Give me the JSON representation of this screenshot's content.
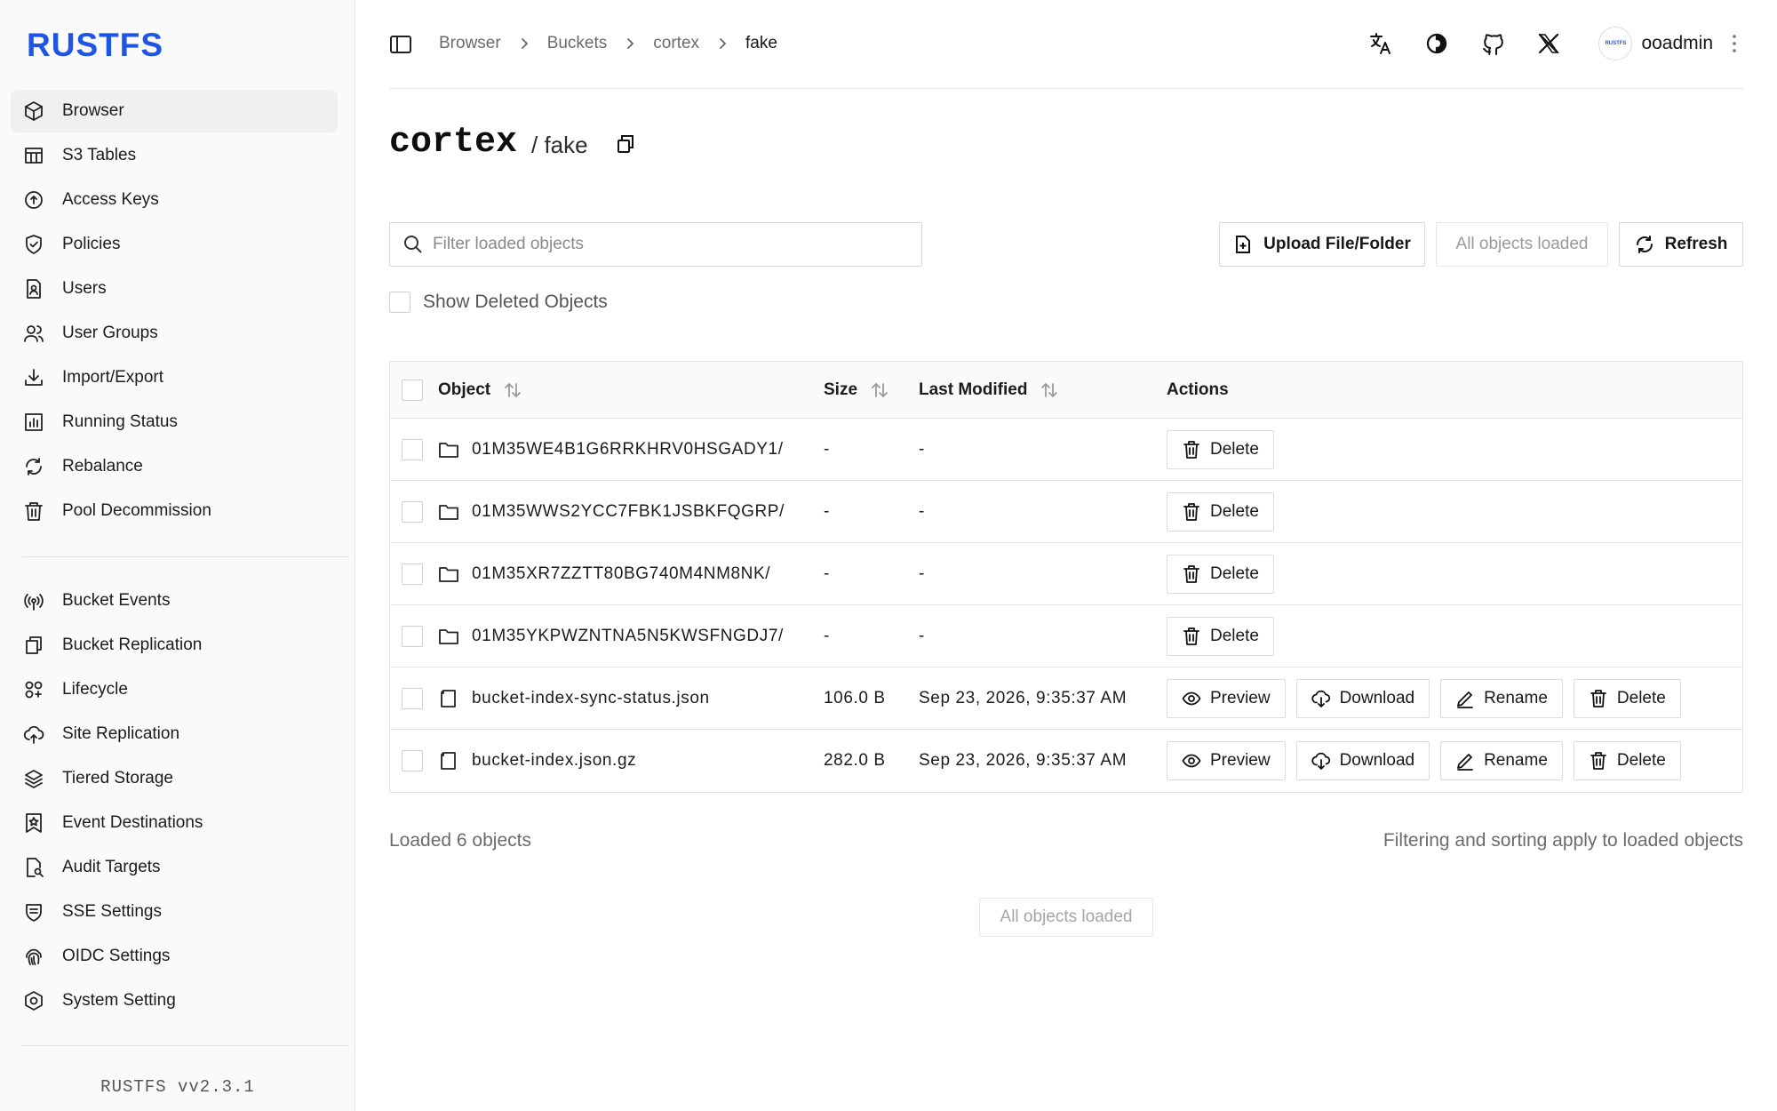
{
  "brand": {
    "logo_text": "RUSTFS",
    "accent": "#1f55e6"
  },
  "sidebar": {
    "primary_items": [
      {
        "label": "Browser",
        "icon": "box-icon",
        "active": true
      },
      {
        "label": "S3 Tables",
        "icon": "table-icon"
      },
      {
        "label": "Access Keys",
        "icon": "key-circle-icon"
      },
      {
        "label": "Policies",
        "icon": "shield-check-icon"
      },
      {
        "label": "Users",
        "icon": "user-badge-icon"
      },
      {
        "label": "User Groups",
        "icon": "users-icon"
      },
      {
        "label": "Import/Export",
        "icon": "import-export-icon"
      },
      {
        "label": "Running Status",
        "icon": "bar-chart-icon"
      },
      {
        "label": "Rebalance",
        "icon": "refresh-icon"
      },
      {
        "label": "Pool Decommission",
        "icon": "trash-icon"
      }
    ],
    "secondary_items": [
      {
        "label": "Bucket Events",
        "icon": "broadcast-icon"
      },
      {
        "label": "Bucket Replication",
        "icon": "copy-icon"
      },
      {
        "label": "Lifecycle",
        "icon": "lifecycle-icon"
      },
      {
        "label": "Site Replication",
        "icon": "cloud-upload-icon"
      },
      {
        "label": "Tiered Storage",
        "icon": "layers-icon"
      },
      {
        "label": "Event Destinations",
        "icon": "star-bookmark-icon"
      },
      {
        "label": "Audit Targets",
        "icon": "file-search-icon"
      },
      {
        "label": "SSE Settings",
        "icon": "encryption-icon"
      },
      {
        "label": "OIDC Settings",
        "icon": "fingerprint-icon"
      },
      {
        "label": "System Setting",
        "icon": "settings-hex-icon"
      }
    ],
    "version": "RUSTFS vv2.3.1"
  },
  "header": {
    "breadcrumbs": [
      "Browser",
      "Buckets",
      "cortex",
      "fake"
    ],
    "username": "ooadmin",
    "avatar_text": "RUSTFS"
  },
  "page": {
    "bucket": "cortex",
    "path": "/ fake"
  },
  "toolbar": {
    "filter_placeholder": "Filter loaded objects",
    "upload_label": "Upload File/Folder",
    "all_loaded_label": "All objects loaded",
    "refresh_label": "Refresh",
    "show_deleted_label": "Show Deleted Objects"
  },
  "table": {
    "columns": {
      "object": "Object",
      "size": "Size",
      "modified": "Last Modified",
      "actions": "Actions"
    },
    "rows": [
      {
        "type": "folder",
        "name": "01M35WE4B1G6RRKHRV0HSGADY1/",
        "size": "-",
        "modified": "-",
        "actions": [
          "Delete"
        ]
      },
      {
        "type": "folder",
        "name": "01M35WWS2YCC7FBK1JSBKFQGRP/",
        "size": "-",
        "modified": "-",
        "actions": [
          "Delete"
        ]
      },
      {
        "type": "folder",
        "name": "01M35XR7ZZTT80BG740M4NM8NK/",
        "size": "-",
        "modified": "-",
        "actions": [
          "Delete"
        ]
      },
      {
        "type": "folder",
        "name": "01M35YKPWZNTNA5N5KWSFNGDJ7/",
        "size": "-",
        "modified": "-",
        "actions": [
          "Delete"
        ]
      },
      {
        "type": "file",
        "name": "bucket-index-sync-status.json",
        "size": "106.0 B",
        "modified": "Sep 23, 2026, 9:35:37 AM",
        "actions": [
          "Preview",
          "Download",
          "Rename",
          "Delete"
        ]
      },
      {
        "type": "file",
        "name": "bucket-index.json.gz",
        "size": "282.0 B",
        "modified": "Sep 23, 2026, 9:35:37 AM",
        "actions": [
          "Preview",
          "Download",
          "Rename",
          "Delete"
        ]
      }
    ]
  },
  "footer": {
    "loaded_text": "Loaded 6 objects",
    "note_text": "Filtering and sorting apply to loaded objects",
    "bottom_badge": "All objects loaded"
  }
}
